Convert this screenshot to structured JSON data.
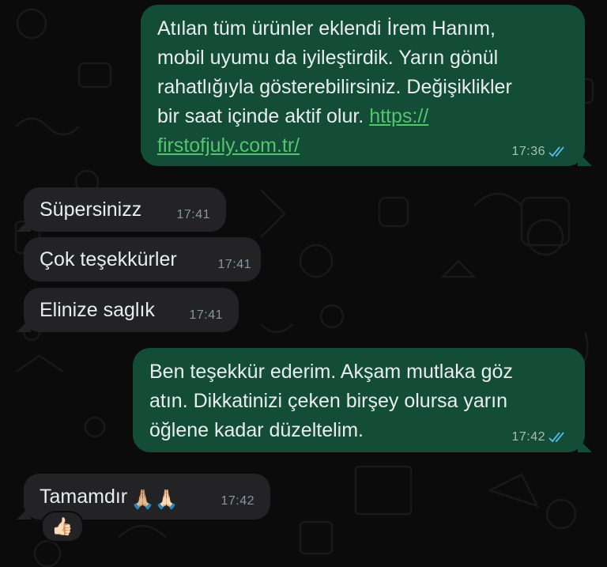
{
  "colors": {
    "outgoing_bubble": "#134d37",
    "incoming_bubble": "#232326",
    "link": "#53c56c",
    "read_ticks": "#53bdeb"
  },
  "messages": [
    {
      "direction": "outgoing",
      "lines": [
        "Atılan tüm ürünler eklendi İrem Hanım,",
        "mobil uyumu da iyileştirdik. Yarın gönül",
        "rahatlığıyla gösterebilirsiniz. Değişiklikler"
      ],
      "line4_text": "bir saat içinde aktif olur. ",
      "link_part1": "https://",
      "link_part2": "firstofjuly.com.tr/",
      "time": "17:36",
      "status": "read"
    },
    {
      "direction": "incoming",
      "text": "Süpersinizz",
      "time": "17:41"
    },
    {
      "direction": "incoming",
      "text": "Çok teşekkürler",
      "time": "17:41"
    },
    {
      "direction": "incoming",
      "text": "Elinize saglık",
      "time": "17:41"
    },
    {
      "direction": "outgoing",
      "lines": [
        "Ben teşekkür ederim. Akşam mutlaka göz",
        "atın. Dikkatinizi çeken birşey olursa yarın",
        "öğlene kadar düzeltelim."
      ],
      "time": "17:42",
      "status": "read"
    },
    {
      "direction": "incoming",
      "text": "Tamamdır",
      "emoji": "🙏🏼🙏🏻",
      "time": "17:42",
      "reaction": "👍🏻"
    }
  ],
  "icons": {
    "read_receipt": "double-check-icon"
  }
}
